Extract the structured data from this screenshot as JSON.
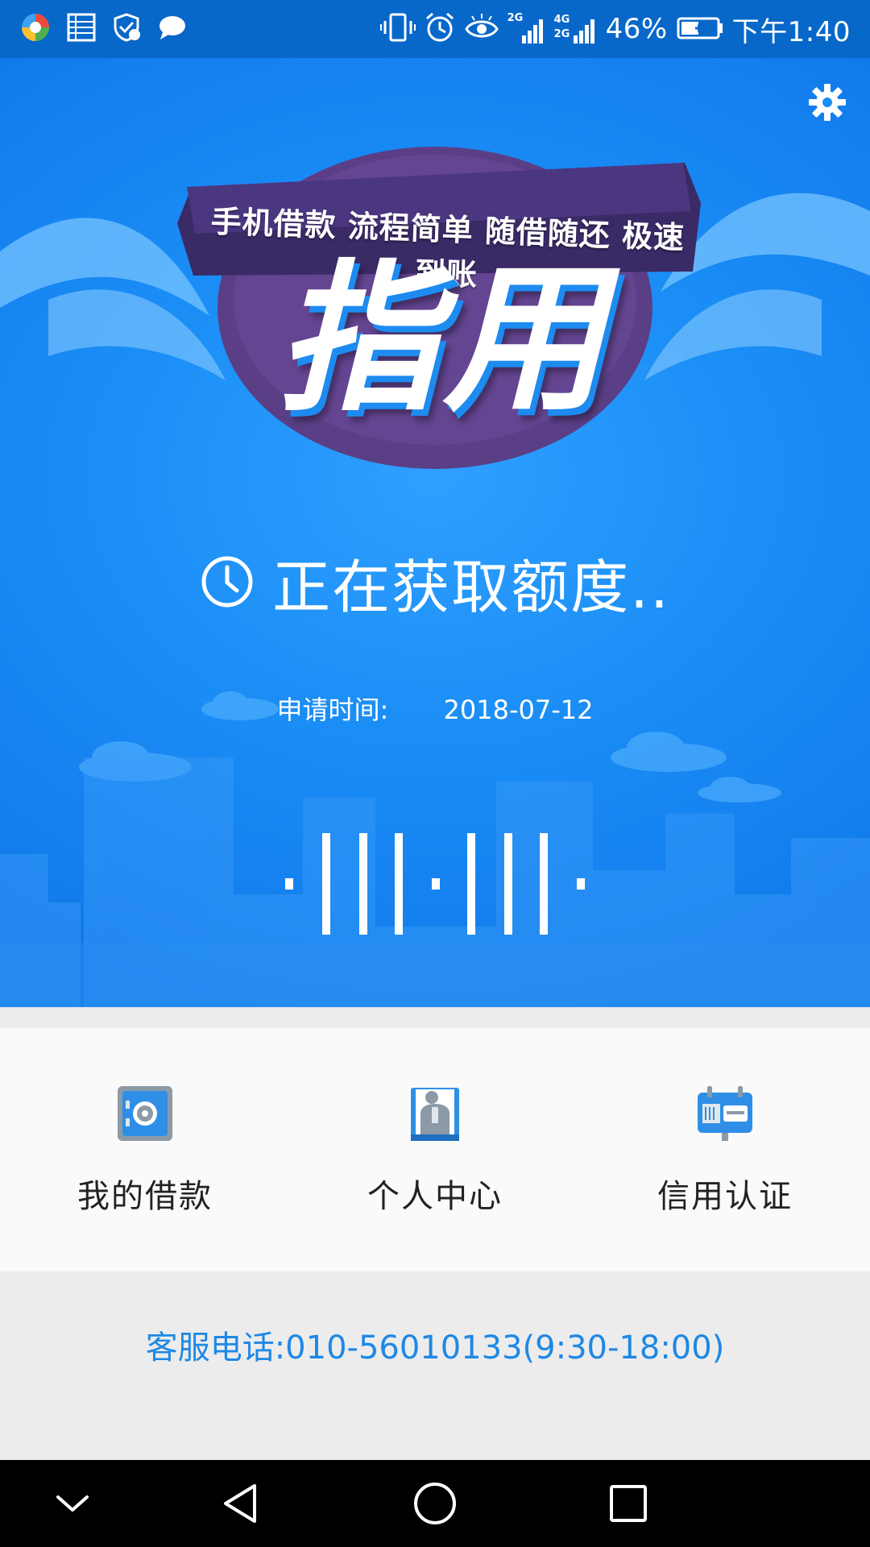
{
  "status_bar": {
    "battery_percent": "46%",
    "time": "下午1:40",
    "signal_1_label": "2G",
    "signal_2_label_top": "4G",
    "signal_2_label_bottom": "2G"
  },
  "header": {
    "banner_tagline": "手机借款 流程简单 随借随还 极速到账",
    "logo_text": "指用",
    "settings_icon": "gear-icon"
  },
  "status": {
    "icon": "clock-icon",
    "text": "正在获取额度.."
  },
  "application": {
    "label": "申请时间:",
    "date": "2018-07-12"
  },
  "menu": {
    "items": [
      {
        "label": "我的借款",
        "icon": "safe-icon"
      },
      {
        "label": "个人中心",
        "icon": "person-icon"
      },
      {
        "label": "信用认证",
        "icon": "id-card-icon"
      }
    ]
  },
  "footer": {
    "hotline": "客服电话:010-56010133(9:30-18:00)"
  },
  "colors": {
    "hero_blue": "#1b8ef6",
    "status_bar_blue": "#0868c9",
    "link_blue": "#1e88e5",
    "menu_icon_gray": "#8c99a6",
    "menu_icon_blue": "#2f8fe6"
  }
}
